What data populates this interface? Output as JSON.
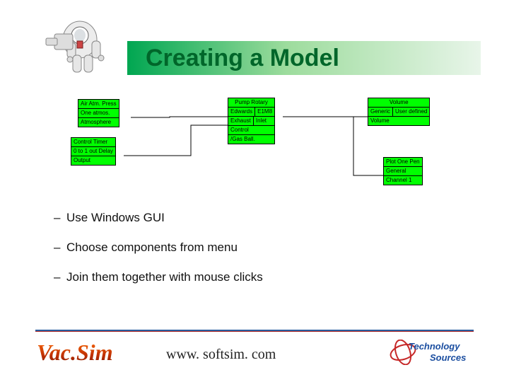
{
  "title": "Creating a Model",
  "blocks": {
    "air": {
      "line1": "Air Atm. Press",
      "line2": "One atmos.",
      "port": "Atmosphere"
    },
    "timer": {
      "line1": "Control Timer",
      "line2": "0 to 1 out Delay",
      "port": "Output"
    },
    "pump": {
      "line1": "Pump Rotary",
      "line2a": "Edwards",
      "line2b": "E1M8",
      "portExhaust": "Exhaust",
      "portInlet": "Inlet",
      "portControl": "Control",
      "portGasBall": "/Gas Ball."
    },
    "volume": {
      "line1": "Volume",
      "line2a": "Generic",
      "line2b": "User defined",
      "port": "Volume"
    },
    "plot": {
      "line1": "Plot One Pen",
      "line2": "General",
      "port": "Channel 1"
    }
  },
  "bullets": [
    "Use Windows GUI",
    "Choose components from menu",
    "Join them together with mouse clicks"
  ],
  "brand": "Vac.Sim",
  "url": "www. softsim. com",
  "sponsor": {
    "line1": "Technology",
    "line2": "Sources"
  },
  "icons": {
    "astronaut": "astronaut-image"
  }
}
